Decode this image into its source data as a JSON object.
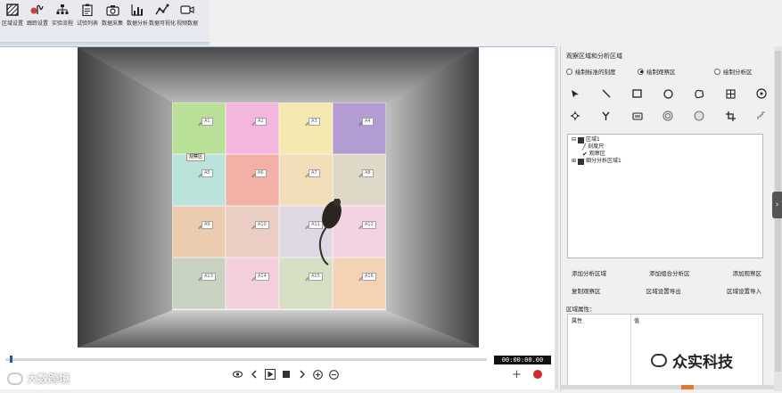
{
  "toolbar": {
    "items": [
      {
        "label": "区域设置",
        "icon": "hatched-square-icon"
      },
      {
        "label": "跟踪设置",
        "icon": "tracking-wave-icon"
      },
      {
        "label": "实验流程",
        "icon": "flowchart-icon"
      },
      {
        "label": "试验列表",
        "icon": "clipboard-list-icon"
      },
      {
        "label": "数据采集",
        "icon": "camera-icon"
      },
      {
        "label": "数据分析",
        "icon": "bar-chart-icon"
      },
      {
        "label": "数据可视化",
        "icon": "line-chart-icon"
      },
      {
        "label": "视频数据",
        "icon": "video-camera-icon"
      }
    ]
  },
  "arena": {
    "cells": [
      {
        "label": "A1",
        "color": "#a6d97a"
      },
      {
        "label": "A2",
        "color": "#f6a2d8"
      },
      {
        "label": "A3",
        "color": "#f6e59a"
      },
      {
        "label": "A4",
        "color": "#9e7fc6"
      },
      {
        "label": "A5",
        "color": "#a8e0d4"
      },
      {
        "label": "A6",
        "color": "#f29a8e"
      },
      {
        "label": "A7",
        "color": "#f3d7a8"
      },
      {
        "label": "A8",
        "color": "#d8d1b8"
      },
      {
        "label": "A9",
        "color": "#eabf98"
      },
      {
        "label": "A10",
        "color": "#e8c1b4"
      },
      {
        "label": "A11",
        "color": "#d6cfe0"
      },
      {
        "label": "A12",
        "color": "#f3c9dc"
      },
      {
        "label": "A13",
        "color": "#b9c9b0"
      },
      {
        "label": "A14",
        "color": "#f4c5d4"
      },
      {
        "label": "A15",
        "color": "#cdd9b4"
      },
      {
        "label": "A16",
        "color": "#f5c8a0"
      }
    ],
    "observation_label": "观察区"
  },
  "player": {
    "timecode": "00:00:00.00",
    "progress": 0.01
  },
  "watermark_left": "大数跨境",
  "panel": {
    "title": "观察区域和分析区域",
    "radio_options": [
      {
        "label": "绘制标准的刻度",
        "selected": false
      },
      {
        "label": "绘制观察区",
        "selected": true
      },
      {
        "label": "绘制分析区",
        "selected": false
      }
    ],
    "draw_tools_row1": [
      "arrow-pointer-icon",
      "line-tool-icon",
      "rectangle-tool-icon",
      "circle-tool-icon",
      "polygon-tool-icon",
      "grid-tool-icon",
      "clock-circle-icon"
    ],
    "draw_tools_row2": [
      "move-cross-icon",
      "y-split-icon",
      "rounded-rect-icon",
      "ring-icon",
      "gradient-circle-icon",
      "crop-icon",
      "resize-corner-icon"
    ],
    "tree": {
      "root": "区域1",
      "children": [
        "刻度尺",
        "观察区"
      ],
      "sibling": "细分分析区域1"
    },
    "actions_row1": [
      "添加分析区域",
      "添加组合分析区",
      "添加观察区"
    ],
    "actions_row2": [
      "复制观察区",
      "区域设置导出",
      "区域设置导入"
    ],
    "props_title": "区域属性：",
    "props_headers": [
      "属性",
      "值"
    ]
  },
  "watermark_right": "众实科技"
}
